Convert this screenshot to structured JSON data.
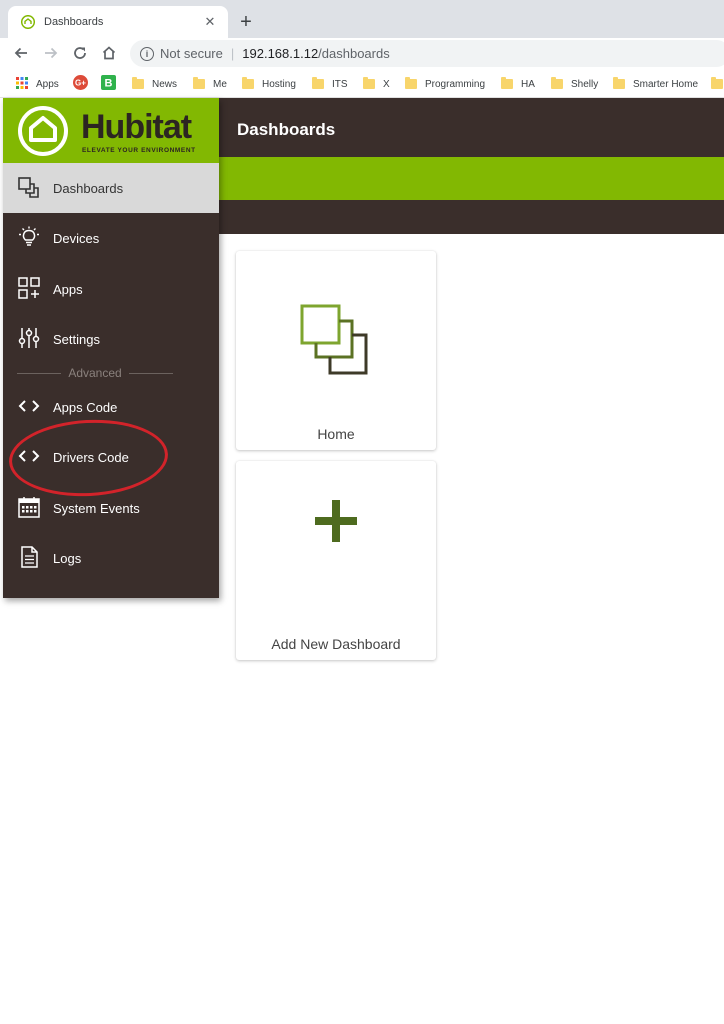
{
  "browser": {
    "tab": {
      "title": "Dashboards",
      "close": "✕"
    },
    "newtab": "+",
    "address": {
      "security": "Not secure",
      "host": "192.168.1.12",
      "path": "/dashboards"
    },
    "bookmarks": [
      {
        "label": "Apps",
        "icon": "apps-grid-icon"
      },
      {
        "label": "",
        "icon": "google-plus-icon"
      },
      {
        "label": "",
        "icon": "b-icon"
      },
      {
        "label": "News",
        "icon": "folder-icon"
      },
      {
        "label": "Me",
        "icon": "folder-icon"
      },
      {
        "label": "Hosting",
        "icon": "folder-icon"
      },
      {
        "label": "ITS",
        "icon": "folder-icon"
      },
      {
        "label": "X",
        "icon": "folder-icon"
      },
      {
        "label": "Programming",
        "icon": "folder-icon"
      },
      {
        "label": "HA",
        "icon": "folder-icon"
      },
      {
        "label": "Shelly",
        "icon": "folder-icon"
      },
      {
        "label": "Smarter Home",
        "icon": "folder-icon"
      }
    ]
  },
  "brand": {
    "name": "Hubitat",
    "tagline": "ELEVATE YOUR ENVIRONMENT",
    "green": "#82b802",
    "dark": "#3a2e2b"
  },
  "header": {
    "title": "Dashboards"
  },
  "sidebar": {
    "items": [
      {
        "label": "Dashboards",
        "icon": "dashboards-icon",
        "active": true
      },
      {
        "label": "Devices",
        "icon": "bulb-icon"
      },
      {
        "label": "Apps",
        "icon": "apps-icon"
      },
      {
        "label": "Settings",
        "icon": "sliders-icon"
      }
    ],
    "section": "Advanced",
    "advanced_items": [
      {
        "label": "Apps Code",
        "icon": "code-icon"
      },
      {
        "label": "Drivers Code",
        "icon": "code-icon",
        "highlighted": true
      },
      {
        "label": "System Events",
        "icon": "calendar-icon"
      },
      {
        "label": "Logs",
        "icon": "document-icon"
      }
    ]
  },
  "dashboards": [
    {
      "label": "Home",
      "icon": "dashboards-icon"
    },
    {
      "label": "Add New Dashboard",
      "icon": "plus-icon"
    }
  ],
  "annotation": {
    "color": "#d2232a"
  }
}
